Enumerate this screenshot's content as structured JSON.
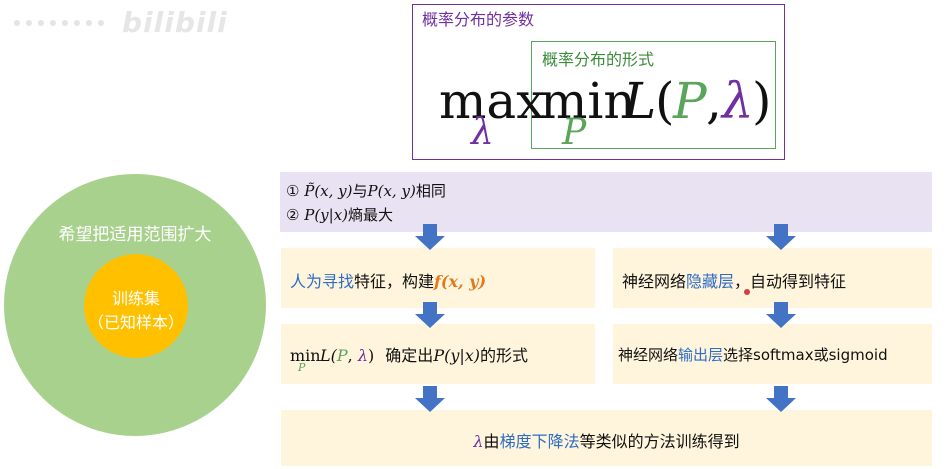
{
  "watermark": {
    "logo_text": "bilibili"
  },
  "top_formula": {
    "outer_label": "概率分布的参数",
    "inner_label": "概率分布的形式",
    "max": "max",
    "max_sub": "λ",
    "min": "min",
    "min_sub": "P",
    "L": "L",
    "lparen": "(",
    "P": "P",
    "comma": ",",
    "lambda": "λ",
    "rparen": ")"
  },
  "circles": {
    "outer_label": "希望把适用范围扩大",
    "inner_line1": "训练集",
    "inner_line2": "（已知样本）"
  },
  "conditions": {
    "c1_num": "①",
    "c1_a": "P̃(x, y)",
    "c1_mid": "与",
    "c1_b": "P(x, y)",
    "c1_end": "相同",
    "c2_num": "②",
    "c2_a": "P(y|x)",
    "c2_end": "熵最大"
  },
  "left_flow": {
    "step1_blue": "人为寻找",
    "step1_rest": "特征，构建",
    "step1_f": "f(x, y)",
    "step2_min": "min",
    "step2_sub": "P",
    "step2_L": "L(",
    "step2_P": "P",
    "step2_comma": ", ",
    "step2_lam": "λ",
    "step2_close": ")",
    "step2_rest": "确定出",
    "step2_form": "P(y|x)",
    "step2_end": "的形式"
  },
  "right_flow": {
    "step1_a": "神经网络",
    "step1_blue": "隐藏层",
    "step1_rest": "，自动得到特征",
    "step2_a": "神经网络",
    "step2_blue": "输出层",
    "step2_rest": "选择softmax或sigmoid"
  },
  "bottom": {
    "lam": "λ",
    "text_a": "由",
    "blue": "梯度下降法",
    "text_b": "等类似的方法训练得到"
  },
  "colors": {
    "purple": "#7030a0",
    "green": "#5aa55a",
    "blue_text": "#2f6cc6",
    "arrow_blue": "#4472c4",
    "orange": "#e07a1f",
    "outer_circle": "#a9d18e",
    "inner_circle": "#ffc000",
    "condition_bg": "#e9e2f2",
    "box_bg": "#fff5dc"
  }
}
